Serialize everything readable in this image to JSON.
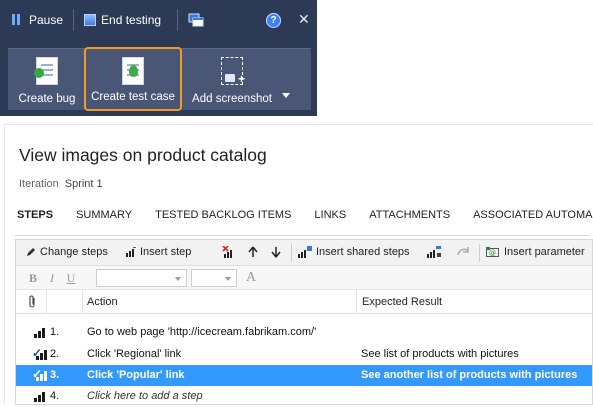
{
  "runner": {
    "pause_label": "Pause",
    "end_testing_label": "End testing",
    "help_glyph": "?",
    "close_glyph": "✕",
    "buttons": {
      "create_bug": "Create bug",
      "create_test_case": "Create test case",
      "add_screenshot": "Add screenshot"
    },
    "highlight_color": "#f39a1f"
  },
  "form": {
    "title": "View images on product catalog",
    "iteration_label": "Iteration",
    "iteration_value": "Sprint 1",
    "tabs": [
      "STEPS",
      "SUMMARY",
      "TESTED BACKLOG ITEMS",
      "LINKS",
      "ATTACHMENTS",
      "ASSOCIATED AUTOMA..."
    ],
    "active_tab": "STEPS"
  },
  "steps_toolbar": {
    "change_steps": "Change steps",
    "insert_step": "Insert step",
    "insert_shared_steps": "Insert shared steps",
    "insert_parameter": "Insert parameter"
  },
  "format_toolbar": {
    "bold": "B",
    "italic": "I",
    "underline": "U",
    "font_color": "A"
  },
  "grid": {
    "headers": {
      "action": "Action",
      "expected": "Expected Result"
    },
    "rows": [
      {
        "num": "1.",
        "action": "Go to web page 'http://icecream.fabrikam.com/'",
        "expected": "",
        "icon": "step-bars-icon",
        "selected": false
      },
      {
        "num": "2.",
        "action": "Click 'Regional' link",
        "expected": "See list of products with pictures",
        "icon": "validate-step-icon",
        "selected": false
      },
      {
        "num": "3.",
        "action": "Click 'Popular' link",
        "expected": "See another list of products with pictures",
        "icon": "validate-step-icon",
        "selected": true
      },
      {
        "num": "4.",
        "action": "Click here to add a step",
        "expected": "",
        "icon": "step-bars-icon",
        "selected": false
      }
    ],
    "selection_color": "#3399ff"
  }
}
